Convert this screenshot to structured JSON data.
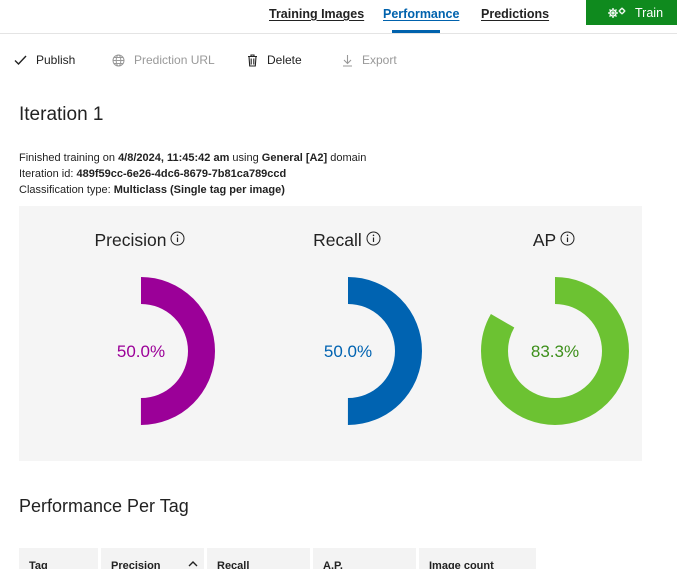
{
  "nav": {
    "tabs": [
      {
        "label": "Training Images"
      },
      {
        "label": "Performance"
      },
      {
        "label": "Predictions"
      }
    ],
    "active_tab": "Performance",
    "train_label": "Train",
    "train_icon": "gears-icon",
    "accent": "#0062ad",
    "train_color": "#0f8a1e"
  },
  "toolbar": {
    "publish": {
      "label": "Publish",
      "icon": "check-icon"
    },
    "prediction_url": {
      "label": "Prediction URL",
      "icon": "globe-icon"
    },
    "delete": {
      "label": "Delete",
      "icon": "trash-icon"
    },
    "export": {
      "label": "Export",
      "icon": "download-icon"
    }
  },
  "iteration": {
    "title": "Iteration 1",
    "finished_prefix": "Finished training on ",
    "finished_date": "4/8/2024, 11:45:42 am",
    "using_text": " using ",
    "domain_name": "General [A2]",
    "domain_suffix": " domain",
    "id_prefix": "Iteration id: ",
    "id_value": "489f59cc-6e26-4dc6-8679-7b81ca789ccd",
    "class_prefix": "Classification type: ",
    "class_value": "Multiclass (Single tag per image)"
  },
  "metrics": [
    {
      "name": "Precision",
      "value_text": "50.0%",
      "fraction": 0.5,
      "color": "#9b0098"
    },
    {
      "name": "Recall",
      "value_text": "50.0%",
      "fraction": 0.5,
      "color": "#0063b1"
    },
    {
      "name": "AP",
      "value_text": "83.3%",
      "fraction": 0.833,
      "color": "#6cc232"
    }
  ],
  "per_tag": {
    "title": "Performance Per Tag",
    "columns": [
      "Tag",
      "Precision",
      "Recall",
      "A.P.",
      "Image count"
    ]
  }
}
